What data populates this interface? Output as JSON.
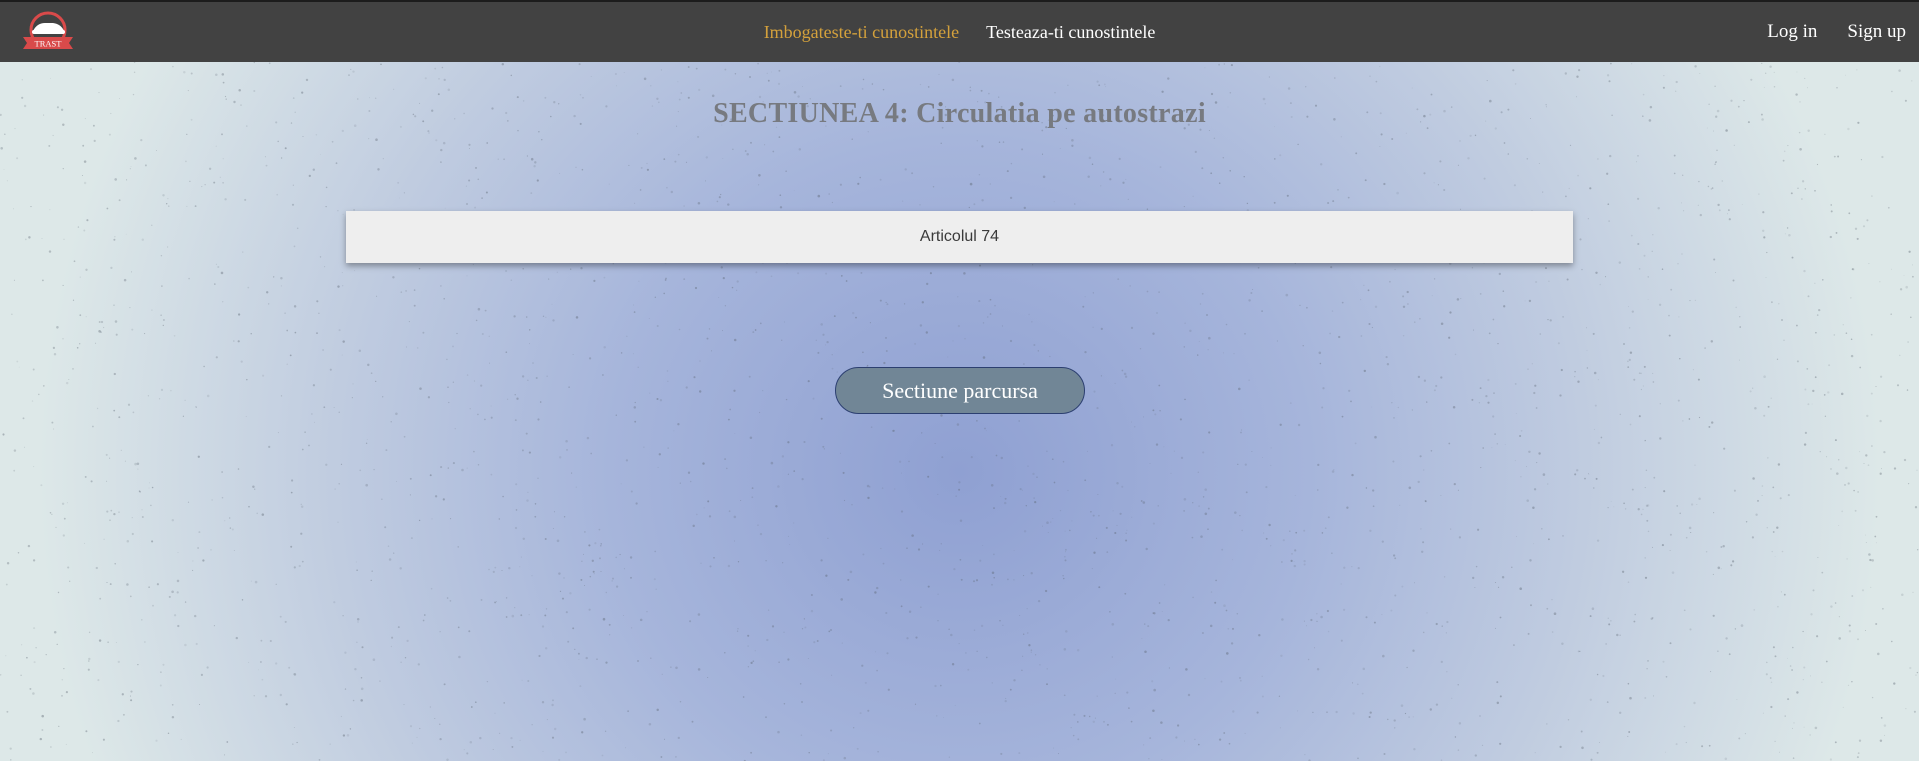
{
  "navbar": {
    "logo_text": "TRAST",
    "links": [
      {
        "label": "Imbogateste-ti cunostintele",
        "active": true
      },
      {
        "label": "Testeaza-ti cunostintele",
        "active": false
      }
    ],
    "login_label": "Log in",
    "signup_label": "Sign up"
  },
  "main": {
    "title": "SECTIUNEA 4: Circulatia pe autostrazi",
    "articles": [
      "Articolul 74"
    ],
    "complete_button_label": "Sectiune parcursa"
  },
  "colors": {
    "navbar_bg": "#424242",
    "active_link": "#d4a13c",
    "logo_red": "#d94a4a",
    "button_bg": "#718696"
  }
}
